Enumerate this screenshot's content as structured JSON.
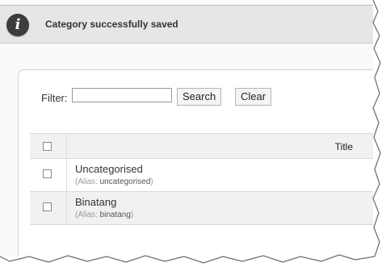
{
  "message": {
    "icon": "info-icon",
    "text": "Category successfully saved"
  },
  "filter": {
    "label": "Filter:",
    "value": "",
    "search_label": "Search",
    "clear_label": "Clear"
  },
  "table": {
    "columns": {
      "title": "Title"
    },
    "rows": [
      {
        "title": "Uncategorised",
        "alias_prefix": "(Alias: ",
        "alias": "uncategorised",
        "alias_suffix": ")"
      },
      {
        "title": "Binatang",
        "alias_prefix": "(Alias: ",
        "alias": "binatang",
        "alias_suffix": ")"
      }
    ]
  },
  "colors": {
    "message_bar": "#e6e6e6",
    "icon_bg": "#3c3c3c",
    "row_alt": "#f1f1f1"
  }
}
